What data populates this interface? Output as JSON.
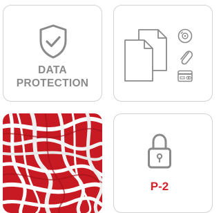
{
  "data_protection": {
    "line1": "DATA",
    "line2": "PROTECTION"
  },
  "security_level": {
    "label": "P-2"
  },
  "colors": {
    "border": "#d2d2d2",
    "icon_gray": "#8a8a8a",
    "accent_red": "#d3222a"
  },
  "icons": {
    "shield": "shield-check-icon",
    "documents": "documents-icon",
    "cd": "cd-disc-icon",
    "paperclip": "paperclip-icon",
    "card": "credit-card-icon",
    "lock": "padlock-icon"
  }
}
